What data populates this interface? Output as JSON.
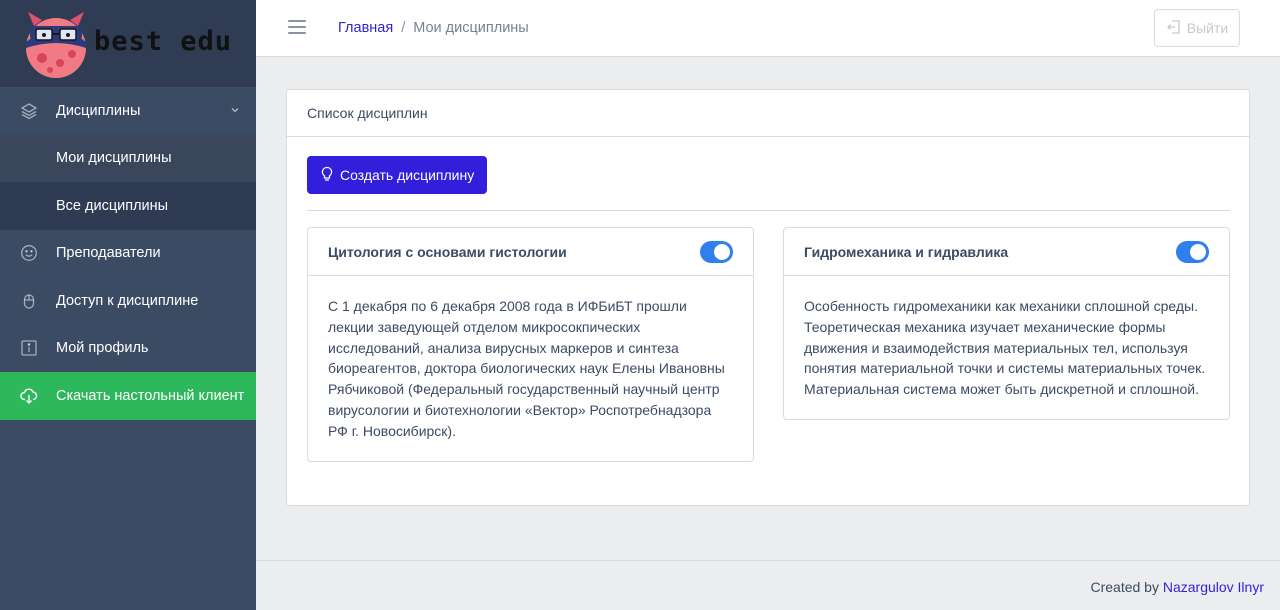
{
  "brand": {
    "logo_text": "best edu"
  },
  "sidebar": {
    "items": [
      {
        "label": "Дисциплины",
        "icon": "layers-icon"
      },
      {
        "label": "Мои дисциплины"
      },
      {
        "label": "Все дисциплины"
      },
      {
        "label": "Преподаватели",
        "icon": "smile-icon"
      },
      {
        "label": "Доступ к дисциплине",
        "icon": "mouse-icon"
      },
      {
        "label": "Мой профиль",
        "icon": "info-icon"
      },
      {
        "label": "Скачать настольный клиент",
        "icon": "cloud-download-icon"
      }
    ]
  },
  "header": {
    "breadcrumb": {
      "home": "Главная",
      "current": "Мои дисциплины"
    },
    "logout_label": "Выйти"
  },
  "main": {
    "card_title": "Список дисциплин",
    "create_button": "Создать дисциплину",
    "disciplines": [
      {
        "title": "Цитология с основами гистологии",
        "enabled": true,
        "description": "С 1 декабря по 6 декабря 2008 года в ИФБиБТ прошли лекции заведующей отделом микросокпических исследований, анализа вирусных маркеров и синтеза биореагентов, доктора биологических наук Елены Ивановны Рябчиковой (Федеральный государственный научный центр вирусологии и биотехнологии «Вектор» Роспотребнадзора РФ г. Новосибирск)."
      },
      {
        "title": "Гидромеханика и гидравлика",
        "enabled": true,
        "description": "Особенность гидромеханики как механики сплошной среды. Теоретическая механика изучает механические формы движения и взаимодействия материальных тел, используя понятия материальной точки и системы материальных точек. Материальная система может быть дискретной и сплошной."
      }
    ]
  },
  "footer": {
    "prefix": "Created by",
    "author": "Nazargulov Ilnyr"
  },
  "colors": {
    "sidebar": "#3c4b64",
    "primary": "#321fdb",
    "success": "#2eb85c",
    "toggle": "#2f80ed"
  }
}
